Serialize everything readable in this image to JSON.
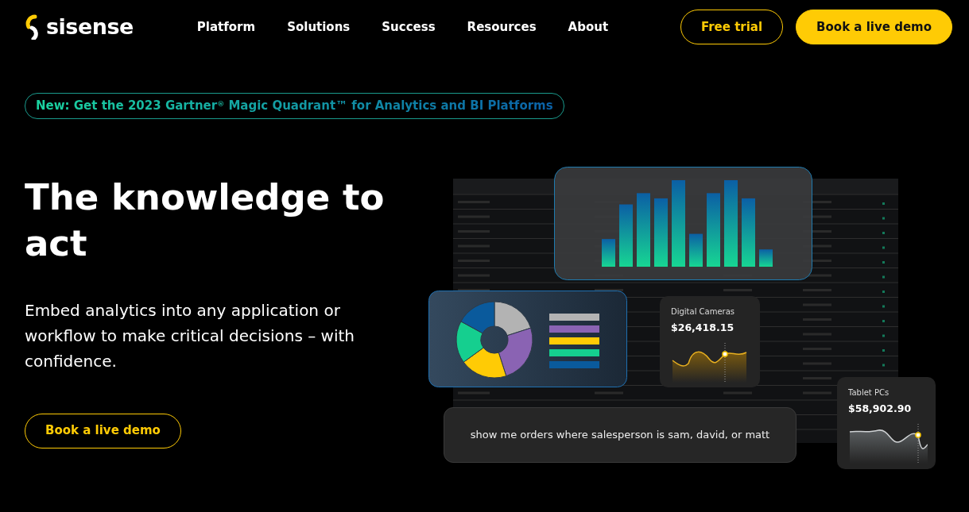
{
  "nav": {
    "logo": "sisense",
    "links": [
      "Platform",
      "Solutions",
      "Success",
      "Resources",
      "About"
    ],
    "buttons": [
      {
        "label": "Free trial",
        "kind": "outline"
      },
      {
        "label": "Book a live demo",
        "kind": "solid"
      }
    ]
  },
  "announcement": "New: Get the 2023 Gartner$^{®}$ Magic Quadrant™ for Analytics and BI Platforms",
  "hero": {
    "title": "The knowledge to act",
    "subtitle": "Embed analytics into any application or workflow to make critical decisions – with confidence.",
    "button": "Book a live demo"
  },
  "illustration": {
    "legend": [
      {
        "color": "#b3b3b3"
      },
      {
        "color": "#8a63b3"
      },
      {
        "color": "#ffcb05"
      },
      {
        "color": "#15cf8f"
      },
      {
        "color": "#0a5a9c"
      }
    ],
    "metrics": [
      {
        "title": "Digital Cameras",
        "value": "$26,418.15",
        "kind": "gold"
      },
      {
        "title": "Tablet PCs",
        "value": "$58,902.90",
        "kind": "grey"
      }
    ],
    "query": "show me orders where salesperson is sam, david, or matt"
  }
}
